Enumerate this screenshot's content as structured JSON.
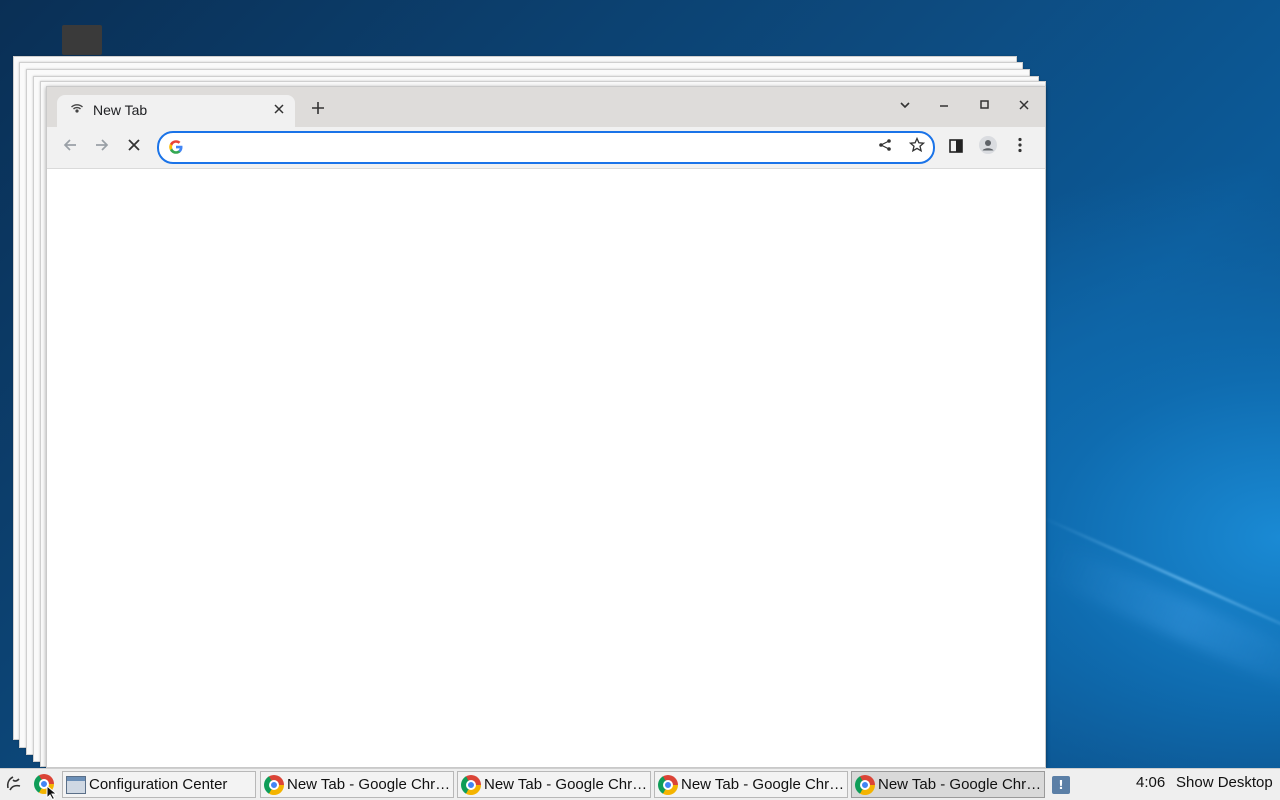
{
  "browser": {
    "tab": {
      "title": "New Tab",
      "favicon": "new-tab-icon",
      "close_icon": "close-icon"
    },
    "new_tab_icon": "plus-icon",
    "window_controls": [
      "chevron-down-icon",
      "minimize-icon",
      "maximize-icon",
      "close-icon"
    ],
    "nav": {
      "back_icon": "back-arrow-icon",
      "forward_icon": "forward-arrow-icon",
      "stop_icon": "stop-icon"
    },
    "omnibox": {
      "value": "",
      "engine_icon": "google-icon",
      "share_icon": "share-icon",
      "bookmark_icon": "star-icon"
    },
    "toolbar_icons": [
      "side-panel-icon",
      "profile-icon",
      "menu-icon"
    ]
  },
  "taskbar": {
    "items": [
      {
        "label": "Configuration Center",
        "icon": "config-window-icon",
        "active": false
      },
      {
        "label": "New Tab - Google Chr…",
        "icon": "chrome-icon",
        "active": false
      },
      {
        "label": "New Tab - Google Chr…",
        "icon": "chrome-icon",
        "active": false
      },
      {
        "label": "New Tab - Google Chr…",
        "icon": "chrome-icon",
        "active": false
      },
      {
        "label": "New Tab - Google Chr…",
        "icon": "chrome-icon",
        "active": true
      }
    ],
    "clock": "4:06",
    "show_desktop": "Show Desktop"
  },
  "colors": {
    "accent": "#1a73e8",
    "titlebar": "#dedcda",
    "toolbar": "#f1f1f1"
  }
}
